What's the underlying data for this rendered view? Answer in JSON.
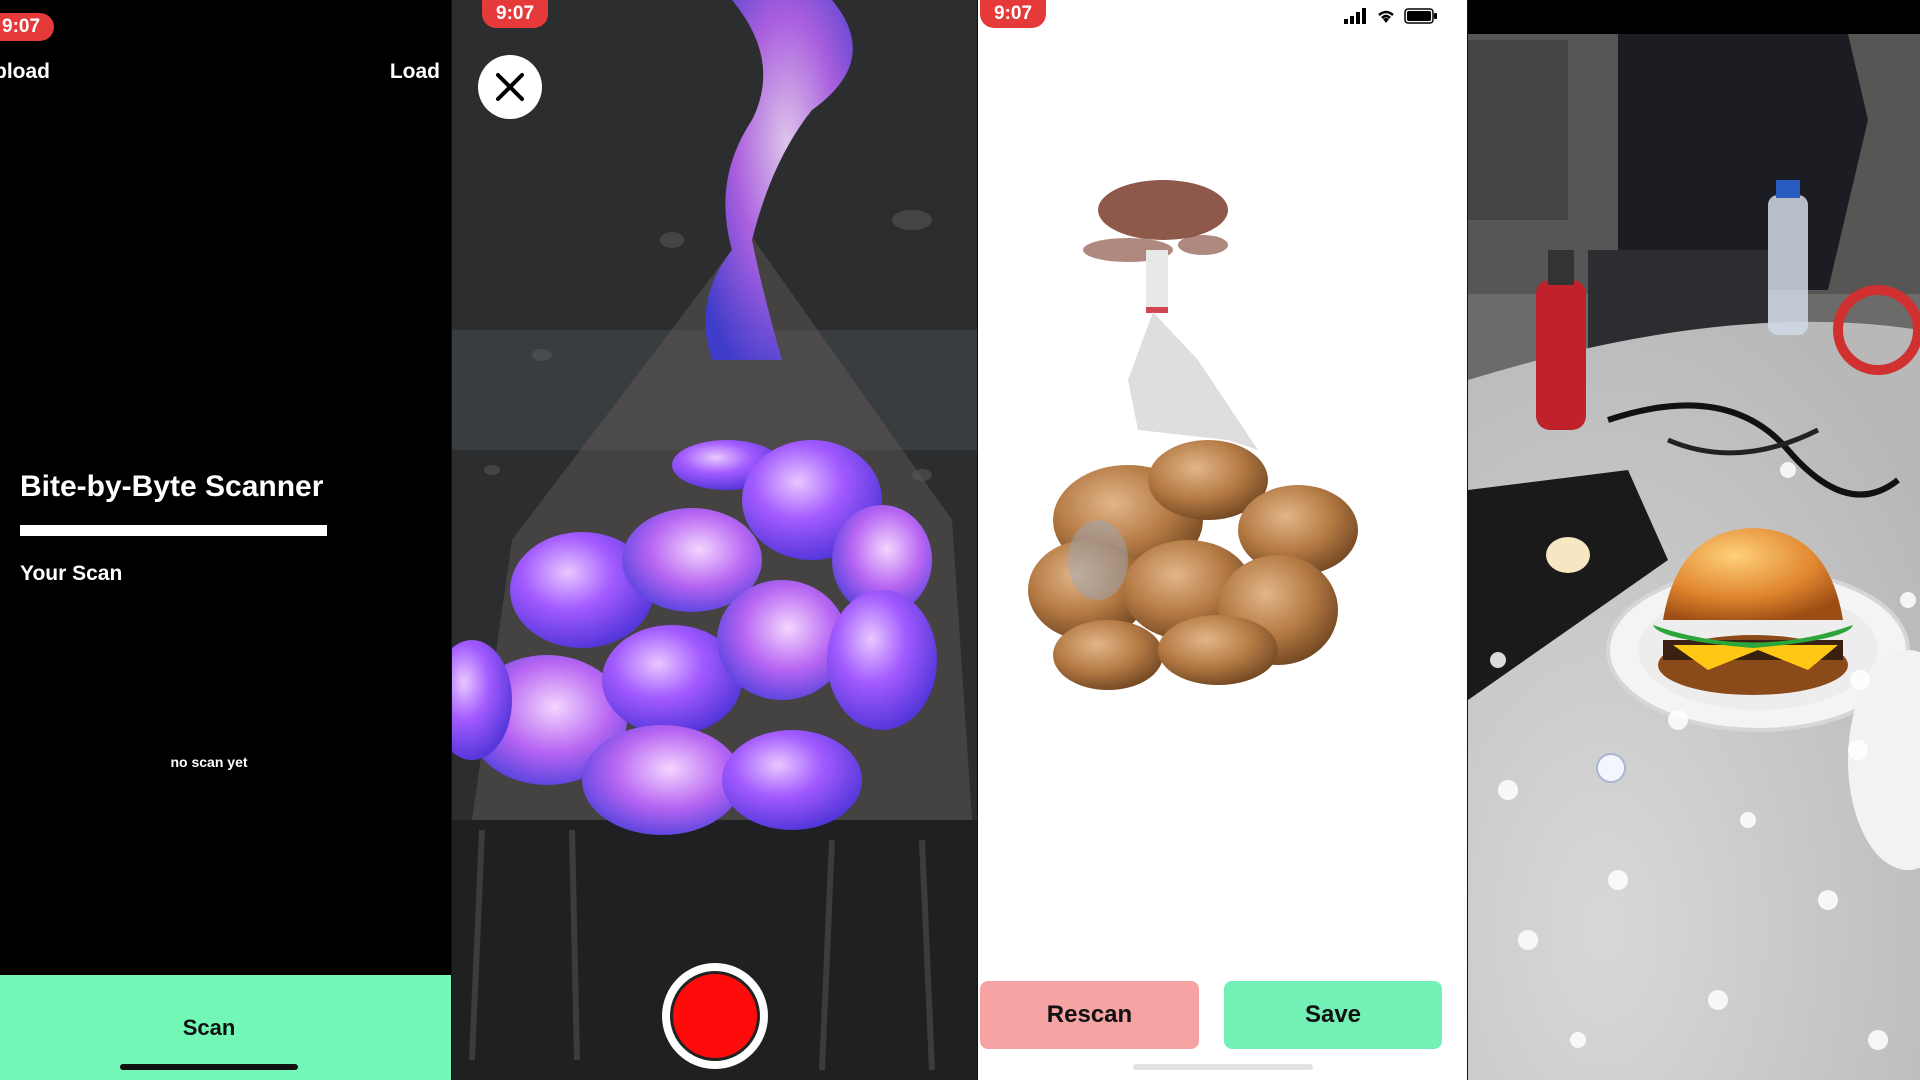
{
  "panel_scanner_home": {
    "time": "9:07",
    "upload_label": "pload",
    "load_label": "Load",
    "title": "Bite-by-Byte Scanner",
    "subtitle": "Your Scan",
    "empty_message": "no scan yet",
    "scan_button_label": "Scan",
    "accent_color": "#73f7b7"
  },
  "panel_scanning": {
    "time": "9:07",
    "close_icon": "close-icon",
    "record_color": "#ff0b0b"
  },
  "panel_review": {
    "time": "9:07",
    "rescan_label": "Rescan",
    "save_label": "Save",
    "rescan_color": "#f6a3a3",
    "save_color": "#73f0b5"
  },
  "panel_ar_view": {
    "description_icon": "burger-model-icon"
  }
}
